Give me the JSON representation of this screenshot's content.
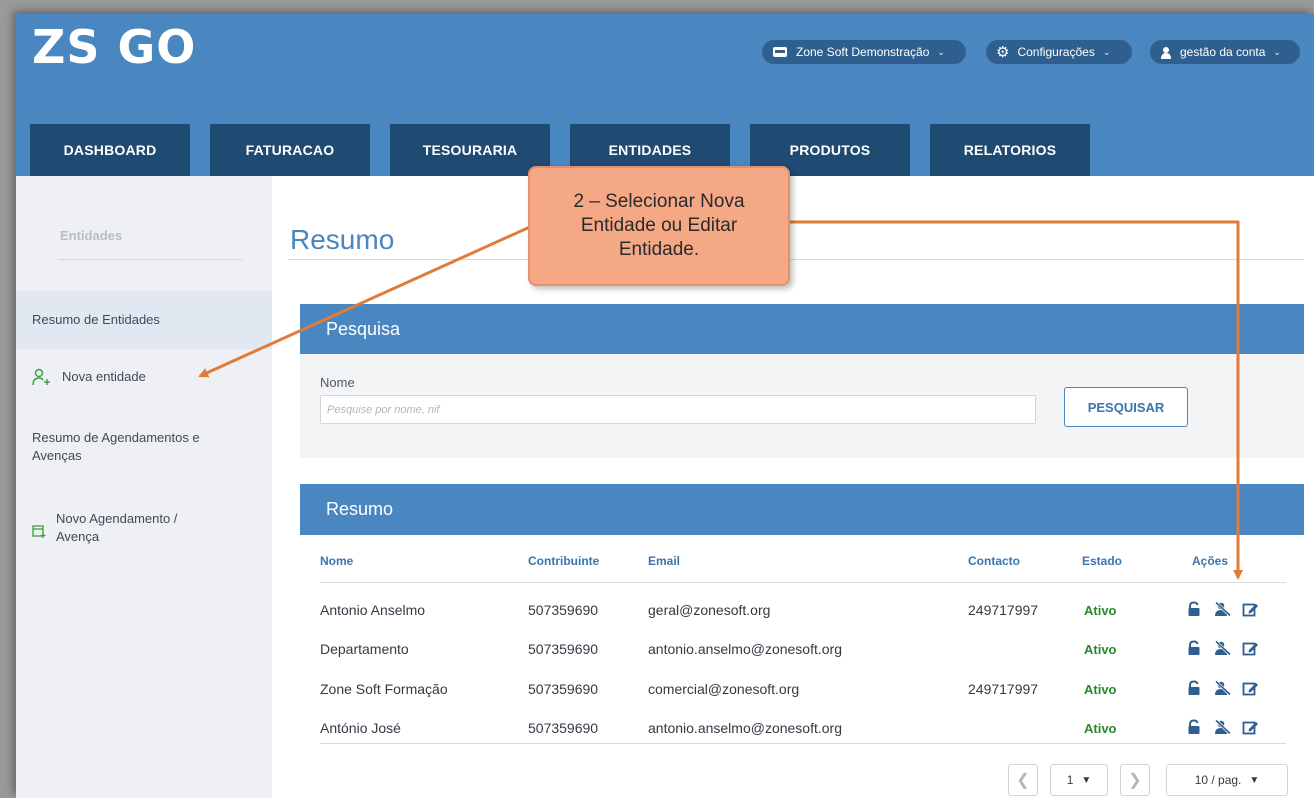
{
  "app": {
    "logo_text": "ZS GO",
    "org_selector": "Zone Soft Demonstração",
    "settings_menu": "Configurações",
    "account_menu": "gestão da conta"
  },
  "tabs": [
    {
      "label": "DASHBOARD"
    },
    {
      "label": "FATURACAO"
    },
    {
      "label": "TESOURARIA"
    },
    {
      "label": "ENTIDADES"
    },
    {
      "label": "PRODUTOS"
    },
    {
      "label": "RELATORIOS"
    }
  ],
  "sidebar": {
    "title": "Entidades",
    "items": [
      {
        "label": "Resumo de Entidades",
        "icon": "none"
      },
      {
        "label": "Nova entidade",
        "icon": "add-person-icon"
      },
      {
        "label": "Resumo de Agendamentos e Avenças",
        "icon": "none"
      },
      {
        "label": "Novo Agendamento / Avença",
        "icon": "calendar-add-icon"
      }
    ]
  },
  "main": {
    "title": "Resumo",
    "search_panel": {
      "heading": "Pesquisa",
      "field_label": "Nome",
      "placeholder": "Pesquise por nome, nif",
      "button": "PESQUISAR"
    },
    "results_panel": {
      "heading": "Resumo",
      "columns": [
        "Nome",
        "Contribuinte",
        "Email",
        "Contacto",
        "Estado",
        "Ações"
      ],
      "rows": [
        {
          "nome": "Antonio Anselmo",
          "contribuinte": "507359690",
          "email": "geral@zonesoft.org",
          "contacto": "249717997",
          "estado": "Ativo"
        },
        {
          "nome": "Departamento",
          "contribuinte": "507359690",
          "email": "antonio.anselmo@zonesoft.org",
          "contacto": "",
          "estado": "Ativo"
        },
        {
          "nome": "Zone Soft Formação",
          "contribuinte": "507359690",
          "email": "comercial@zonesoft.org",
          "contacto": "249717997",
          "estado": "Ativo"
        },
        {
          "nome": "António José",
          "contribuinte": "507359690",
          "email": "antonio.anselmo@zonesoft.org",
          "contacto": "",
          "estado": "Ativo"
        }
      ],
      "action_icons": [
        "lock-icon",
        "user-block-icon",
        "edit-icon"
      ]
    },
    "pagination": {
      "page": "1",
      "per_page": "10 / pag."
    }
  },
  "annotation": {
    "text": "2 – Selecionar Nova Entidade ou Editar Entidade.",
    "color": "#f4a886",
    "arrow_color": "#e07b39"
  },
  "colors": {
    "header": "#4a86c0",
    "tab": "#1f4a72",
    "status_active": "#2a8a2a"
  }
}
